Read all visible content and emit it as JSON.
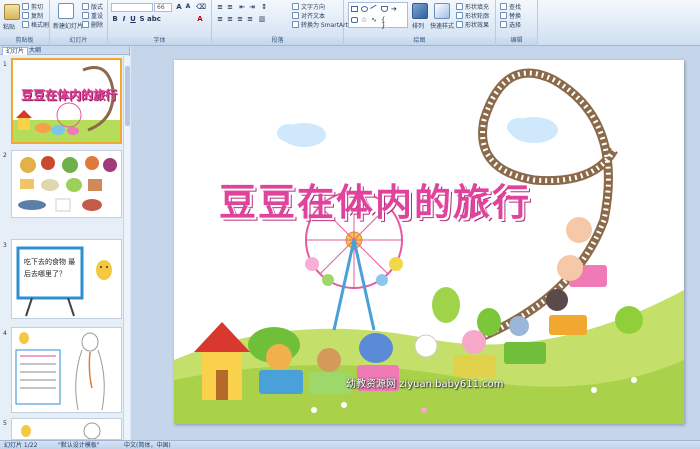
{
  "ribbon": {
    "groups": {
      "clipboard": "剪贴板",
      "slides": "幻灯片",
      "font": "字体",
      "paragraph": "段落",
      "drawing": "绘图",
      "editing": "编辑"
    },
    "paste": "粘贴",
    "cut": "剪切",
    "copy": "复制",
    "format_painter": "格式刷",
    "new_slide": "新建幻灯片",
    "layout": "版式",
    "reset": "重设",
    "delete": "删除",
    "font_size": "66",
    "text_direction": "文字方向",
    "align_text": "对齐文本",
    "convert_smartart": "转换为 SmartArt",
    "arrange": "排列",
    "quick_styles": "快速样式",
    "shape_fill": "形状填充",
    "shape_outline": "形状轮廓",
    "shape_effects": "形状效果",
    "find": "查找",
    "replace": "替换",
    "select": "选择"
  },
  "pane": {
    "tab_slides": "幻灯片",
    "tab_outline": "大纲",
    "thumbs": [
      {
        "num": "1",
        "title": "豆豆在体内的旅行"
      },
      {
        "num": "2",
        "title": ""
      },
      {
        "num": "3",
        "title": "吃下去的食物 最后去哪里了？"
      },
      {
        "num": "4",
        "title": ""
      },
      {
        "num": "5",
        "title": ""
      }
    ]
  },
  "slide": {
    "title": "豆豆在体内的旅行",
    "watermark": "幼教资源网 ziyuan.baby611.com"
  },
  "status": {
    "slide_count": "幻灯片 1/22",
    "theme": "\"默认设计模板\"",
    "language": "中文(简体，中国)"
  },
  "colors": {
    "title_pink": "#e0429c",
    "selected_border": "#f0a830"
  }
}
